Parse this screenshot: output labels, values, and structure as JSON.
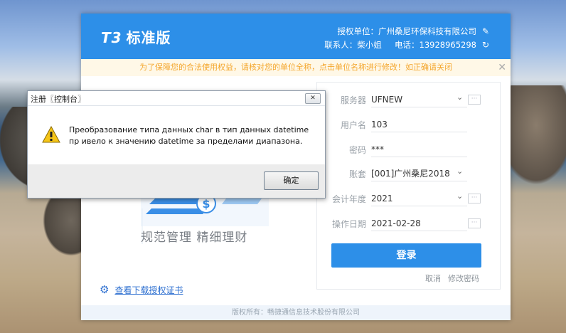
{
  "app": {
    "logo_prefix": "T3",
    "logo_title": "标准版",
    "licensee": "授权单位：广州桑尼环保科技有限公司",
    "contact": "联系人：柴小姐",
    "phone": "电话：13928965298",
    "notice": "为了保障您的合法使用权益，请核对您的单位全称，点击单位名称进行修改！如正确请关闭",
    "slogan": "规范管理   精细理财",
    "download_link": "查看下载授权证书",
    "copyright": "版权所有：畅捷通信息技术股份有限公司"
  },
  "form": {
    "server_label": "服务器",
    "server_value": "UFNEW",
    "user_label": "用户名",
    "user_value": "103",
    "password_label": "密码",
    "password_value": "***",
    "account_label": "账套",
    "account_value": "[001]广州桑尼2018",
    "year_label": "会计年度",
    "year_value": "2021",
    "date_label": "操作日期",
    "date_value": "2021-02-28",
    "login_button": "登录",
    "cancel_link": "取消",
    "change_password_link": "修改密码"
  },
  "dialog": {
    "title": "注册〖控制台〗",
    "message": "Преобразование типа данных char в тип данных datetime пр ивело к значению datetime за пределами диапазона.",
    "ok_button": "确定"
  },
  "icons": {
    "edit": "pencil-icon",
    "refresh": "refresh-icon",
    "close": "close-icon",
    "warning": "warning-icon",
    "certificate": "certificate-icon"
  },
  "colors": {
    "brand_blue": "#2d8fe8",
    "notice_text": "#f4a62c"
  }
}
